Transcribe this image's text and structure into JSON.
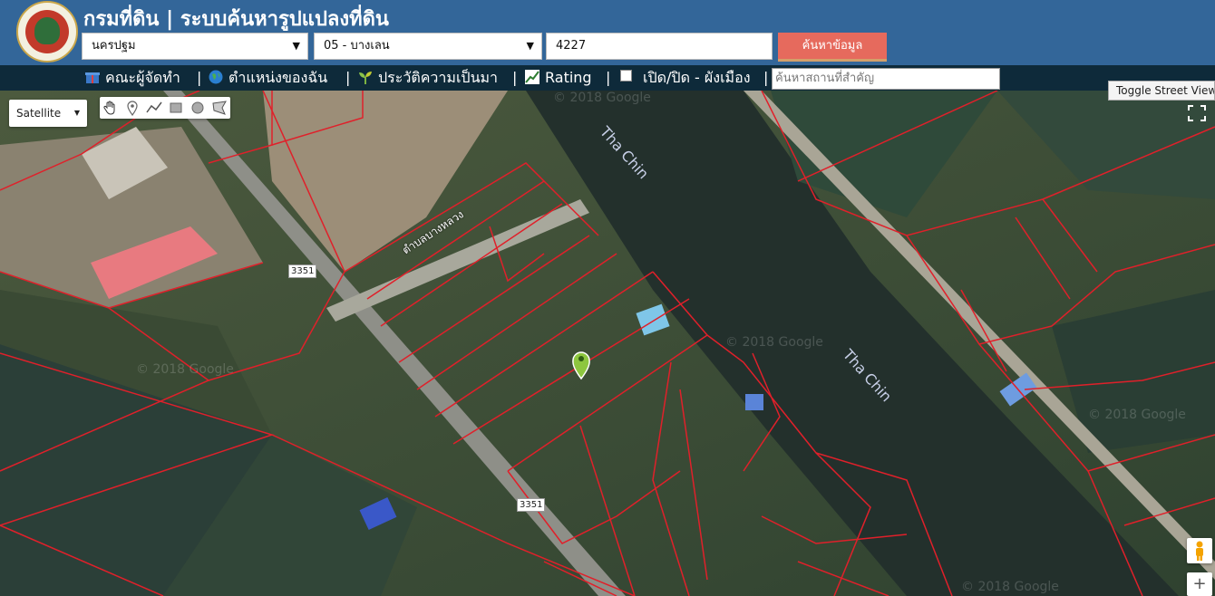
{
  "header": {
    "title": "กรมที่ดิน | ระบบค้นหารูปแปลงที่ดิน",
    "province": "นครปฐม",
    "district": "05 - บางเลน",
    "parcel_number": "4227",
    "search_button": "ค้นหาข้อมูล"
  },
  "nav": {
    "team": "คณะผู้จัดทำ",
    "my_location": "ตำแหน่งของฉัน",
    "history": "ประวัติความเป็นมา",
    "rating": "Rating",
    "toggle_plan": "เปิด/ปิด - ผังเมือง",
    "sep": "|",
    "place_search_placeholder": "ค้นหาสถานที่สำคัญ"
  },
  "map": {
    "map_type": "Satellite",
    "street_view_button": "Toggle Street View",
    "zoom_in": "+",
    "river_label_1": "Tha Chin",
    "river_label_2": "Tha Chin",
    "road_number_1": "3351",
    "road_number_2": "3351",
    "road_name": "ตำบลบางหลวง",
    "google_watermark_1": "© 2018 Google",
    "google_watermark_2": "© 2018 Google",
    "google_watermark_3": "© 2018 Google",
    "google_watermark_4": "© 2018 Google",
    "google_watermark_5": "© 2018 Google"
  },
  "icons": [
    "hand-icon",
    "marker-icon",
    "polyline-icon",
    "rectangle-icon",
    "circle-icon",
    "polygon-icon",
    "fullscreen-icon",
    "pegman-icon",
    "gift-icon",
    "globe-icon",
    "sprout-icon",
    "chart-icon",
    "checkbox-icon"
  ],
  "colors": {
    "header_bg": "#336699",
    "nav_bg": "#0e2a3a",
    "search_button": "#e66a5d",
    "parcel_lines": "#e0202a",
    "map_pin": "#8dc63f"
  }
}
